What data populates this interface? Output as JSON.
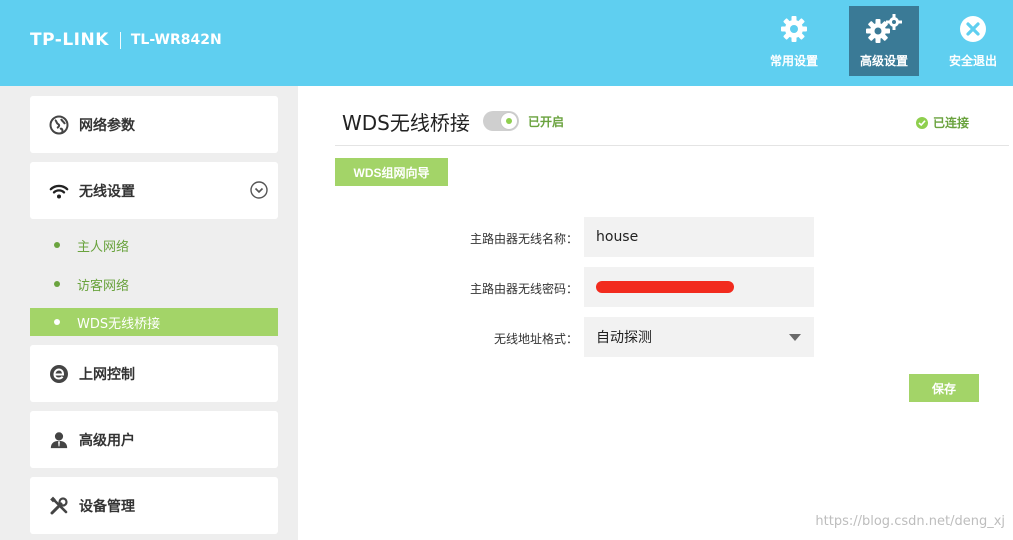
{
  "header": {
    "logo": "TP-LINK",
    "model": "TL-WR842N",
    "nav": [
      {
        "label": "常用设置",
        "icon": "gear-icon"
      },
      {
        "label": "高级设置",
        "icon": "gears-icon",
        "active": true
      },
      {
        "label": "安全退出",
        "icon": "close-circle-icon"
      }
    ]
  },
  "sidebar": {
    "items": [
      {
        "label": "网络参数",
        "icon": "globe-icon"
      },
      {
        "label": "无线设置",
        "icon": "wifi-icon",
        "expanded": true
      },
      {
        "label": "上网控制",
        "icon": "ie-icon"
      },
      {
        "label": "高级用户",
        "icon": "user-icon"
      },
      {
        "label": "设备管理",
        "icon": "tools-icon"
      }
    ],
    "sub_items": [
      {
        "label": "主人网络"
      },
      {
        "label": "访客网络"
      },
      {
        "label": "WDS无线桥接",
        "active": true
      }
    ]
  },
  "main": {
    "title": "WDS无线桥接",
    "toggle_state": "已开启",
    "connection_status": "已连接",
    "wizard_button": "WDS组网向导",
    "form": {
      "ssid_label": "主路由器无线名称：",
      "ssid_value": "house",
      "password_label": "主路由器无线密码：",
      "address_label": "无线地址格式：",
      "address_value": "自动探测"
    },
    "save_button": "保存"
  },
  "watermark": "https://blog.csdn.net/deng_xj",
  "colors": {
    "header_bg": "#5fcff0",
    "active_nav_bg": "#3a7a96",
    "accent_green": "#a3d468",
    "text_green": "#6aa33e",
    "sidebar_bg": "#eeeeee"
  }
}
